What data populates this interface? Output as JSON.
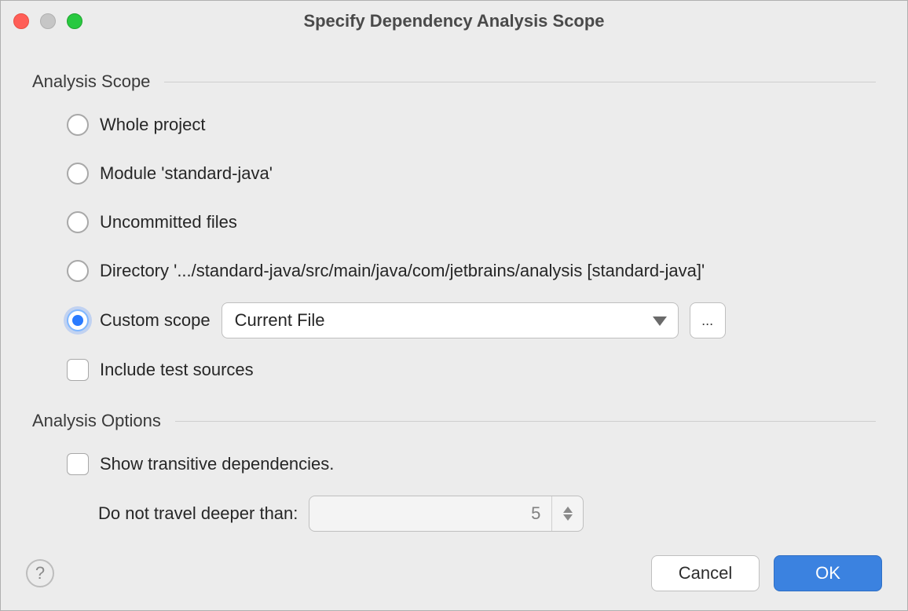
{
  "window": {
    "title": "Specify Dependency Analysis Scope"
  },
  "scope": {
    "section_label": "Analysis Scope",
    "options": {
      "whole_project": "Whole project",
      "module": "Module 'standard-java'",
      "uncommitted": "Uncommitted files",
      "directory": "Directory '.../standard-java/src/main/java/com/jetbrains/analysis [standard-java]'",
      "custom": "Custom scope"
    },
    "selected": "custom",
    "custom_dropdown": {
      "value": "Current File"
    },
    "include_tests": {
      "label": "Include test sources",
      "checked": false
    }
  },
  "options": {
    "section_label": "Analysis Options",
    "show_transitive": {
      "label": "Show transitive dependencies.",
      "checked": false
    },
    "depth": {
      "label": "Do not travel deeper than:",
      "value": "5"
    }
  },
  "buttons": {
    "cancel": "Cancel",
    "ok": "OK"
  }
}
